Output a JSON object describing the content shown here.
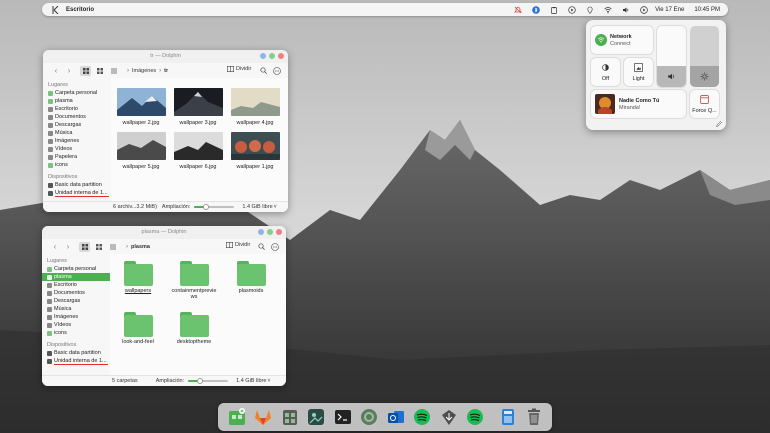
{
  "panel": {
    "title": "Escritorio",
    "date": "Vie 17 Ene",
    "time": "10:45 PM",
    "tray_icons": [
      "notifications-off-icon",
      "bluetooth-icon",
      "clipboard-icon",
      "media-play-icon",
      "location-icon",
      "wifi-icon",
      "volume-icon",
      "control-center-icon"
    ]
  },
  "window1": {
    "title": "tr — Dolphin",
    "breadcrumb": [
      "Imágenes",
      "tr"
    ],
    "split_label": "Dividir",
    "sidebar": {
      "places_header": "Lugares",
      "places": [
        "Carpeta personal",
        "plasma",
        "Escritorio",
        "Documentos",
        "Descargas",
        "Música",
        "Imágenes",
        "Vídeos",
        "Papelera",
        "icons"
      ],
      "devices_header": "Dispositivos",
      "devices": [
        "Basic data partition",
        "Unidad interna de 1..."
      ]
    },
    "files": [
      "wallpaper 2.jpg",
      "wallpaper 3.jpg",
      "wallpaper 4.jpg",
      "wallpaper 5.jpg",
      "wallpaper 6.jpg",
      "wallpaper 1.jpg"
    ],
    "status": "6 archiv...3.2 MiB)",
    "zoom_label": "Ampliación:",
    "zoom_level": 0.3,
    "free_space": "1.4 GiB libre"
  },
  "window2": {
    "title": "plasma — Dolphin",
    "breadcrumb": [
      "plasma"
    ],
    "split_label": "Dividir",
    "sidebar": {
      "places_header": "Lugares",
      "places": [
        "Carpeta personal",
        "plasma",
        "Escritorio",
        "Documentos",
        "Descargas",
        "Música",
        "Imágenes",
        "Vídeos",
        "icons"
      ],
      "selected": "plasma",
      "devices_header": "Dispositivos",
      "devices": [
        "Basic data partition",
        "Unidad interna de 1..."
      ]
    },
    "folders": [
      "wallpapers",
      "containmentpreviews",
      "plasmoids",
      "look-and-feel",
      "desktoptheme"
    ],
    "status": "5 carpetas",
    "zoom_label": "Ampliación:",
    "zoom_level": 0.3,
    "free_space": "1.4 GiB libre"
  },
  "control_center": {
    "network_label": "Network",
    "network_status": "Connect",
    "night_label": "Off",
    "theme_label": "Light",
    "media_title": "Nadie Como Tú",
    "media_artist": "Miranda!",
    "force_quit_label": "Force Q...",
    "volume_level": 0.35,
    "brightness_level": 0.35
  },
  "dock": {
    "items": [
      "add-apps-icon",
      "gitlab-icon",
      "package-store-icon",
      "terminal-preview-icon",
      "terminal-icon",
      "chrome-icon",
      "outlook-icon",
      "spotify-icon",
      "downloader-icon",
      "spotify-icon",
      "calculator-icon",
      "trash-icon"
    ]
  },
  "colors": {
    "accent": "#4caf50",
    "selection": "#4caf50",
    "close": "#f08080",
    "maximize": "#86cf8a",
    "minimize": "#8fb4e8"
  }
}
